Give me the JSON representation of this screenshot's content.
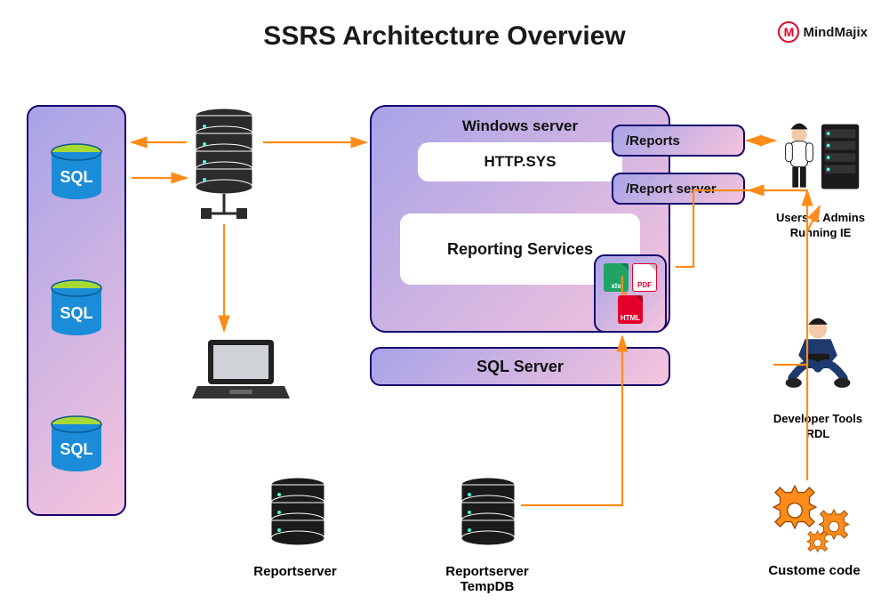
{
  "title": "SSRS Architecture Overview",
  "brand": "MindMajix",
  "sql_label": "SQL",
  "windows": {
    "title": "Windows server",
    "http": "HTTP.SYS",
    "reporting": "Reporting Services"
  },
  "sqlserver": "SQL Server",
  "endpoints": {
    "reports": "/Reports",
    "reportserver": "/Report server"
  },
  "files": {
    "xls": "xls",
    "pdf": "PDF",
    "html": "HTML"
  },
  "users_admins": {
    "line1": "Users & Admins",
    "line2": "Running IE"
  },
  "developer": {
    "line1": "Developer Tools",
    "line2": "RDL"
  },
  "custom_code": "Custome code",
  "reportserver": "Reportserver",
  "reportserver_tempdb_l1": "Reportserver",
  "reportserver_tempdb_l2": "TempDB"
}
